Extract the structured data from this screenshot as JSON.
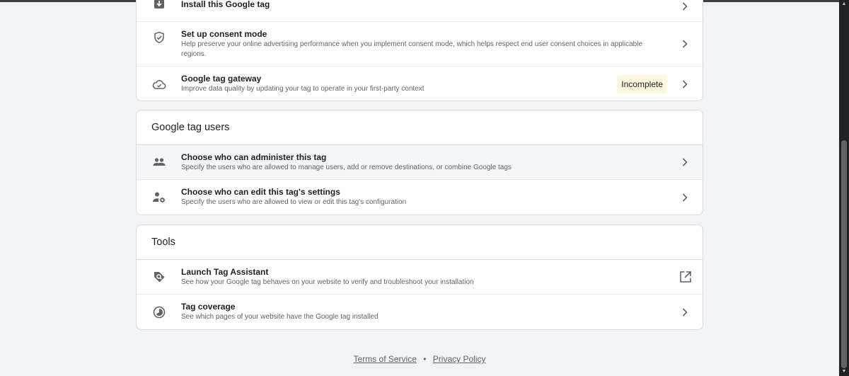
{
  "card1": {
    "rows": [
      {
        "title": "Install this Google tag",
        "desc": ""
      },
      {
        "title": "Set up consent mode",
        "desc": "Help preserve your online advertising performance when you implement consent mode, which helps respect end user consent choices in applicable regions."
      },
      {
        "title": "Google tag gateway",
        "desc": "Improve data quality by updating your tag to operate in your first-party context",
        "badge": "Incomplete"
      }
    ]
  },
  "users": {
    "header": "Google tag users",
    "rows": [
      {
        "title": "Choose who can administer this tag",
        "desc": "Specify the users who are allowed to manage users, add or remove destinations, or combine Google tags"
      },
      {
        "title": "Choose who can edit this tag's settings",
        "desc": "Specify the users who are allowed to view or edit this tag's configuration"
      }
    ]
  },
  "tools": {
    "header": "Tools",
    "rows": [
      {
        "title": "Launch Tag Assistant",
        "desc": "See how your Google tag behaves on your website to verify and troubleshoot your installation"
      },
      {
        "title": "Tag coverage",
        "desc": "See which pages of your website have the Google tag installed"
      }
    ]
  },
  "footer": {
    "terms": "Terms of Service",
    "separator": "•",
    "privacy": "Privacy Policy"
  }
}
